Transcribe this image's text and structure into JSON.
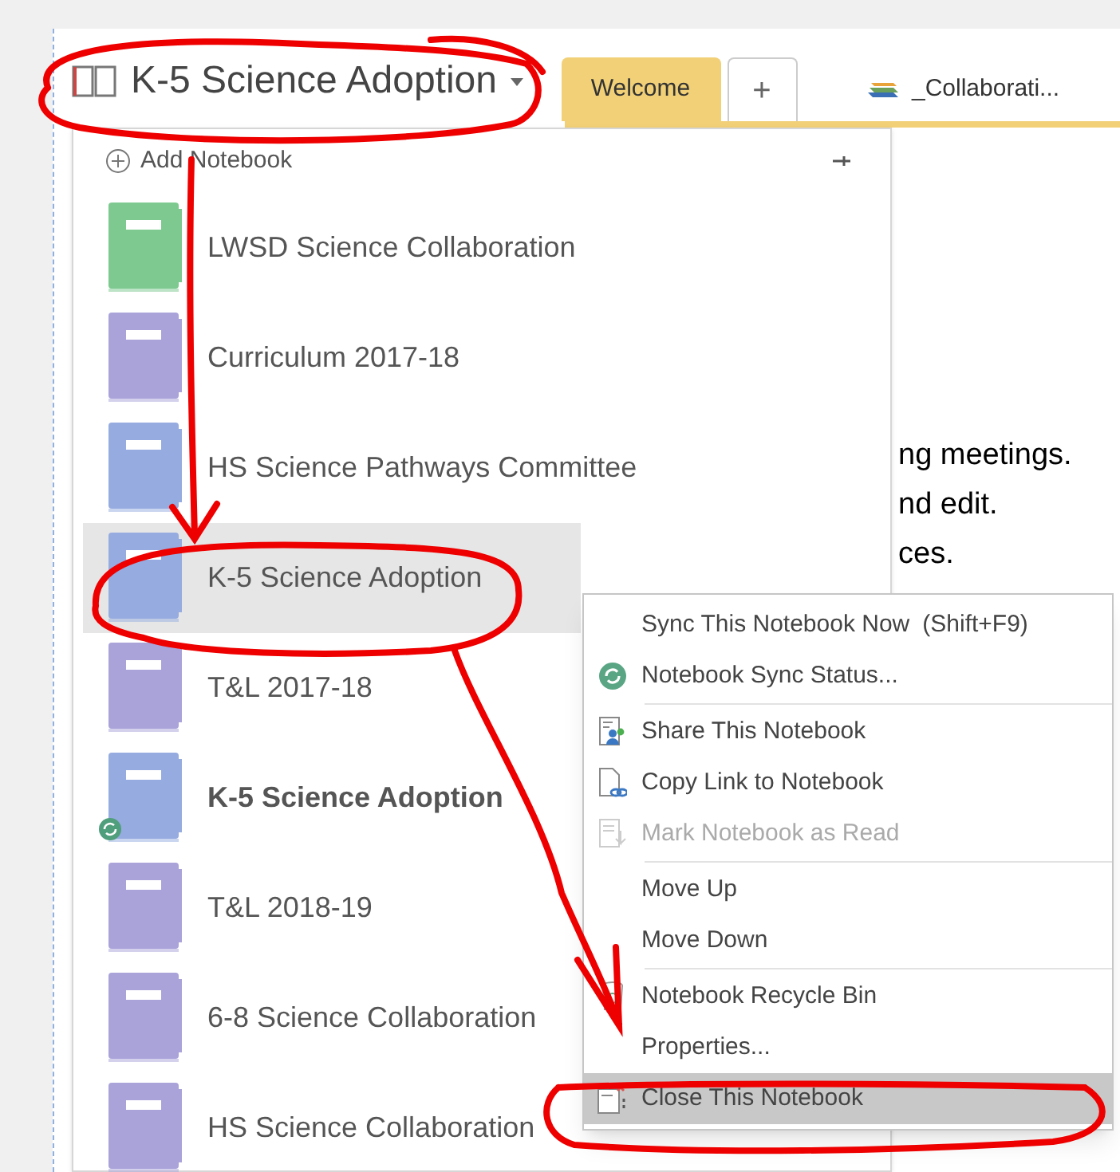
{
  "notebook_picker": {
    "title": "K-5 Science Adoption"
  },
  "tabs": [
    {
      "label": "Welcome",
      "selected": true
    },
    {
      "label": "+",
      "selected": false
    },
    {
      "label": "_Collaborati...",
      "selected": false
    }
  ],
  "notebook_panel": {
    "add_label": "Add Notebook",
    "notebooks": [
      {
        "name": "LWSD Science Collaboration",
        "color": "#7dc98f",
        "selected": false,
        "bold": false,
        "syncing": false
      },
      {
        "name": "Curriculum 2017-18",
        "color": "#aaa3da",
        "selected": false,
        "bold": false,
        "syncing": false
      },
      {
        "name": "HS Science Pathways Committee",
        "color": "#96abdf",
        "selected": false,
        "bold": false,
        "syncing": false
      },
      {
        "name": "K-5 Science Adoption",
        "color": "#96abdf",
        "selected": true,
        "bold": false,
        "syncing": false
      },
      {
        "name": "T&L 2017-18",
        "color": "#aaa3da",
        "selected": false,
        "bold": false,
        "syncing": false
      },
      {
        "name": "K-5 Science Adoption",
        "color": "#96abdf",
        "selected": false,
        "bold": true,
        "syncing": true
      },
      {
        "name": "T&L 2018-19",
        "color": "#aaa3da",
        "selected": false,
        "bold": false,
        "syncing": false
      },
      {
        "name": "6-8 Science Collaboration",
        "color": "#aaa3da",
        "selected": false,
        "bold": false,
        "syncing": false
      },
      {
        "name": "HS Science Collaboration",
        "color": "#aaa3da",
        "selected": false,
        "bold": false,
        "syncing": false
      }
    ]
  },
  "page_text": [
    "ng meetings.",
    "nd edit.",
    "ces."
  ],
  "context_menu": [
    {
      "label": "Sync This Notebook Now",
      "shortcut": "(Shift+F9)",
      "disabled": false,
      "selected": false,
      "separator_before": false
    },
    {
      "label": "Notebook Sync Status...",
      "disabled": false,
      "selected": false,
      "separator_before": false
    },
    {
      "label": "Share This Notebook",
      "disabled": false,
      "selected": false,
      "separator_before": true
    },
    {
      "label": "Copy Link to Notebook",
      "disabled": false,
      "selected": false,
      "separator_before": false
    },
    {
      "label": "Mark Notebook as Read",
      "disabled": true,
      "selected": false,
      "separator_before": false
    },
    {
      "label": "Move Up",
      "disabled": false,
      "selected": false,
      "separator_before": true
    },
    {
      "label": "Move Down",
      "disabled": false,
      "selected": false,
      "separator_before": false
    },
    {
      "label": "Notebook Recycle Bin",
      "disabled": false,
      "selected": false,
      "separator_before": true
    },
    {
      "label": "Properties...",
      "disabled": false,
      "selected": false,
      "separator_before": false
    },
    {
      "label": "Close This Notebook",
      "disabled": false,
      "selected": true,
      "separator_before": false
    }
  ],
  "annotations": [
    {
      "kind": "ellipse"
    },
    {
      "kind": "arrow"
    },
    {
      "kind": "ellipse"
    },
    {
      "kind": "arrow"
    },
    {
      "kind": "ellipse"
    }
  ]
}
